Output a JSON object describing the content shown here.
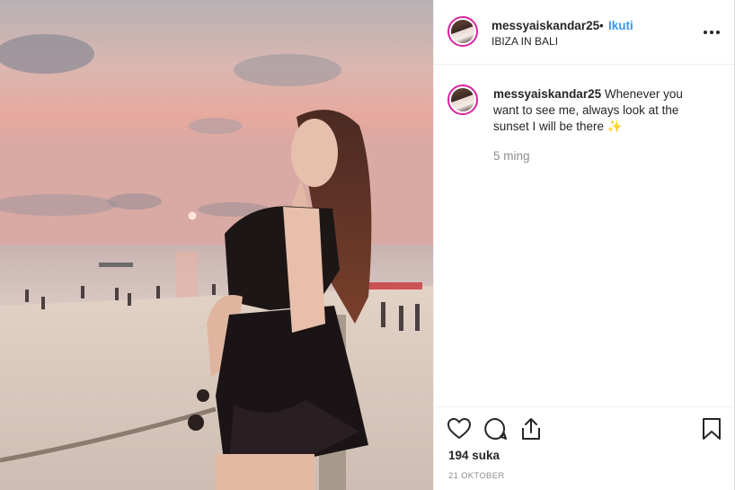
{
  "post": {
    "username": "messyaiskandar25",
    "separator": "•",
    "follow_label": "Ikuti",
    "location": "IBIZA IN BALI",
    "caption_username": "messyaiskandar25",
    "caption_text": "Whenever you want to see me, always look at the sunset I will be there ✨",
    "time_ago": "5 ming",
    "likes": "194 suka",
    "date": "21 OKTOBER"
  },
  "icons": [
    "more-options-icon",
    "heart-icon",
    "comment-icon",
    "share-icon",
    "bookmark-icon"
  ],
  "colors": {
    "follow": "#3897f0",
    "text": "#262626",
    "muted": "#8e8e8e",
    "avatar_ring": "#d6249f"
  }
}
